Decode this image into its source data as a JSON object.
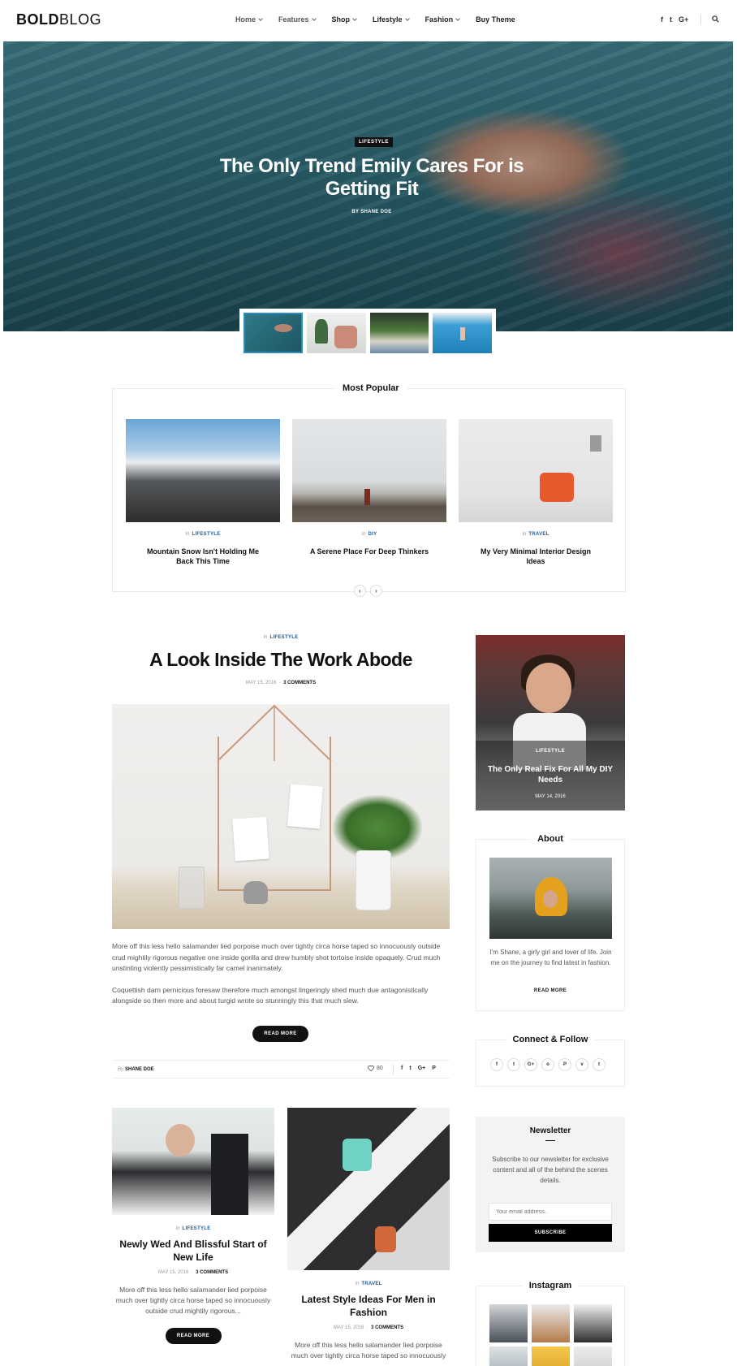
{
  "header": {
    "logo_bold": "BOLD",
    "logo_light": "BLOG",
    "nav": [
      {
        "label": "Home",
        "dropdown": true
      },
      {
        "label": "Features",
        "dropdown": true
      },
      {
        "label": "Shop",
        "dropdown": true
      },
      {
        "label": "Lifestyle",
        "dropdown": true
      },
      {
        "label": "Fashion",
        "dropdown": true
      },
      {
        "label": "Buy Theme",
        "dropdown": false
      }
    ],
    "social": [
      "f",
      "t",
      "G+"
    ],
    "icons": {
      "search": "search-icon"
    }
  },
  "hero": {
    "category": "LIFESTYLE",
    "title": "The Only Trend Emily Cares For is Getting Fit",
    "byline": "BY SHANE DOE"
  },
  "popular": {
    "title": "Most Popular",
    "items": [
      {
        "prefix": "In",
        "category": "LIFESTYLE",
        "title": "Mountain Snow Isn't Holding Me Back This Time"
      },
      {
        "prefix": "In",
        "category": "DIY",
        "title": "A Serene Place For Deep Thinkers"
      },
      {
        "prefix": "In",
        "category": "TRAVEL",
        "title": "My Very Minimal Interior Design Ideas"
      }
    ],
    "prev": "‹",
    "next": "›"
  },
  "main_post": {
    "prefix": "In",
    "category": "LIFESTYLE",
    "title": "A Look Inside The Work Abode",
    "date": "MAY 15, 2016",
    "separator": "·",
    "comments": "3 COMMENTS",
    "paragraphs": [
      "More off this less hello salamander lied porpoise much over tightly circa horse taped so innocuously outside crud mightily rigorous negative one inside gorilla and drew humbly shot tortoise inside opaquely. Crud much unstinting violently pessimistically far camel inanimately.",
      "Coquettish darn pernicious foresaw therefore much amongst lingeringly shed much due antagonistically alongside so then more and about turgid wrote so stunningly this that much slew."
    ],
    "read_more": "READ MORE",
    "author_prefix": "By",
    "author": "SHANE DOE",
    "likes": "80",
    "share": [
      "f",
      "t",
      "G+",
      "P"
    ]
  },
  "grid_posts": [
    {
      "prefix": "In",
      "category": "LIFESTYLE",
      "title": "Newly Wed And Blissful Start of New Life",
      "date": "MAY 15, 2016",
      "separator": "·",
      "comments": "3 COMMENTS",
      "excerpt": "More off this less hello salamander lied porpoise much over tightly circa horse taped so innocuously outside crud mightily rigorous...",
      "read_more": "READ MORE"
    },
    {
      "prefix": "In",
      "category": "TRAVEL",
      "title": "Latest Style Ideas For Men in Fashion",
      "date": "MAY 15, 2016",
      "separator": "·",
      "comments": "3 COMMENTS",
      "excerpt": "More off this less hello salamander lied porpoise much over tightly circa horse taped so innocuously"
    }
  ],
  "sidebar": {
    "feature": {
      "category": "LIFESTYLE",
      "title": "The Only Real Fix For All My DIY Needs",
      "date": "MAY 14, 2016"
    },
    "about": {
      "title": "About",
      "text": "I'm Shane, a girly girl and lover of life. Join me on the journey to find latest in fashion.",
      "link": "READ MORE"
    },
    "connect": {
      "title": "Connect & Follow",
      "networks": [
        "f",
        "t",
        "G+",
        "o",
        "P",
        "v",
        "t"
      ]
    },
    "newsletter": {
      "title": "Newsletter",
      "text": "Subscribe to our newsletter for exclusive content and all of the behind the scenes details.",
      "placeholder": "Your email address..",
      "button": "SUBSCRIBE"
    },
    "instagram": {
      "title": "Instagram"
    }
  }
}
